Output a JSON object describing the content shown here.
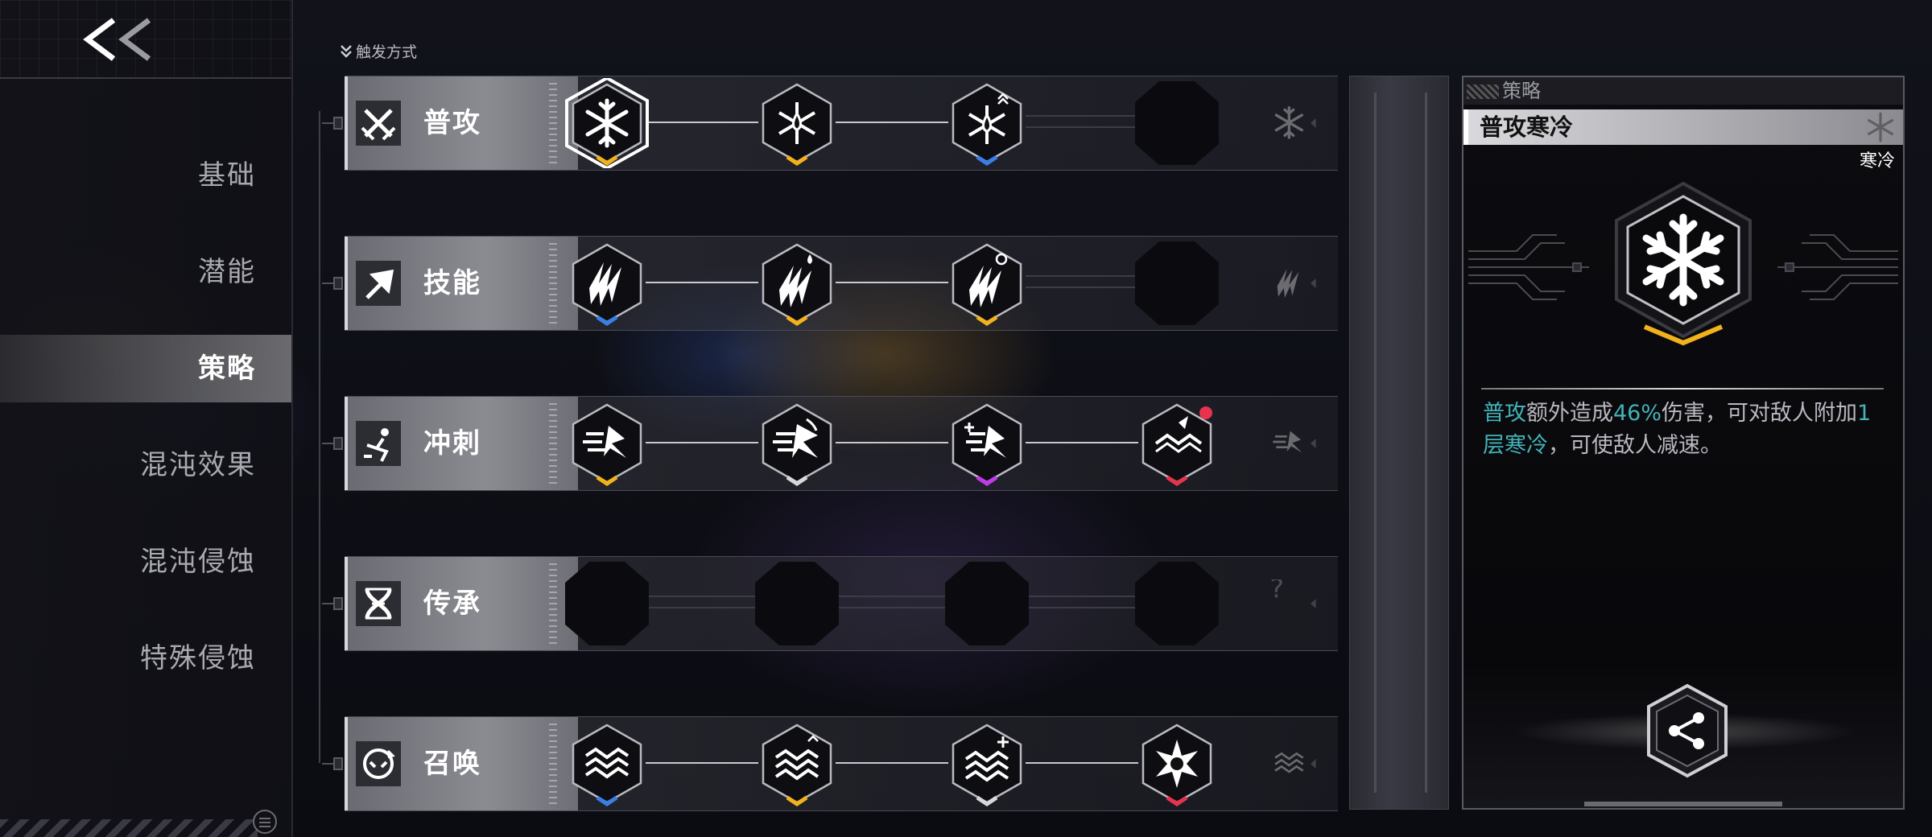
{
  "nav": {
    "back_label": "<<",
    "items": [
      {
        "label": "基础"
      },
      {
        "label": "潜能"
      },
      {
        "label": "策略"
      },
      {
        "label": "混沌效果"
      },
      {
        "label": "混沌侵蚀"
      },
      {
        "label": "特殊侵蚀"
      }
    ],
    "active": "策略"
  },
  "main": {
    "trigger_label": "触发方式",
    "rows": [
      {
        "label": "普攻",
        "icon": "crossed-swords-icon",
        "nodes": [
          {
            "icon": "snowflake-icon",
            "accent": "#f2b21c",
            "selected": true
          },
          {
            "icon": "snowflake-drop-icon",
            "accent": "#f2b21c"
          },
          {
            "icon": "snowflake-drop-up-icon",
            "accent": "#3a7ee8"
          },
          {
            "icon": "empty-slot",
            "accent": ""
          }
        ],
        "ghost": "snowflake-icon"
      },
      {
        "label": "技能",
        "icon": "arrow-up-right-icon",
        "nodes": [
          {
            "icon": "slash-claw-icon",
            "accent": "#3a7ee8"
          },
          {
            "icon": "slash-claw-drop-icon",
            "accent": "#f2b21c"
          },
          {
            "icon": "slash-claw-swirl-icon",
            "accent": "#f2b21c"
          },
          {
            "icon": "empty-slot",
            "accent": ""
          }
        ],
        "ghost": "slash-claw-icon"
      },
      {
        "label": "冲刺",
        "icon": "dash-runner-icon",
        "nodes": [
          {
            "icon": "dash-wind-icon",
            "accent": "#f2b21c"
          },
          {
            "icon": "dash-wing-icon",
            "accent": "#d8d8dc"
          },
          {
            "icon": "dash-plus-icon",
            "accent": "#c23ae8"
          },
          {
            "icon": "wave-dagger-icon",
            "accent": "#e8334f",
            "new_dot": true
          }
        ],
        "ghost": "dash-wind-icon"
      },
      {
        "label": "传承",
        "icon": "dna-icon",
        "nodes": [
          {
            "icon": "empty-slot",
            "accent": ""
          },
          {
            "icon": "empty-slot",
            "accent": ""
          },
          {
            "icon": "empty-slot",
            "accent": ""
          },
          {
            "icon": "empty-slot",
            "accent": ""
          }
        ],
        "ghost": "question-icon"
      },
      {
        "label": "召唤",
        "icon": "summon-circle-icon",
        "nodes": [
          {
            "icon": "wave-weave-icon",
            "accent": "#3a7ee8"
          },
          {
            "icon": "wave-weave-up-icon",
            "accent": "#f2b21c"
          },
          {
            "icon": "wave-weave-plus-icon",
            "accent": "#d8d8dc"
          },
          {
            "icon": "star-burst-icon",
            "accent": "#e8334f"
          }
        ],
        "ghost": "wave-weave-icon"
      }
    ]
  },
  "detail": {
    "category": "策略",
    "title": "普攻寒冷",
    "tag": "寒冷",
    "icon": "snowflake-icon",
    "icon_accent": "#f2b21c",
    "desc": {
      "p1": "普攻",
      "p2": "额外造成",
      "p3": "46%",
      "p4": "伤害，可对敌人附加",
      "p5": "1层",
      "p6": "寒冷",
      "p7": "，可使敌人减速。"
    },
    "share_icon": "share-icon",
    "highlight_color": "#42b3b8"
  }
}
